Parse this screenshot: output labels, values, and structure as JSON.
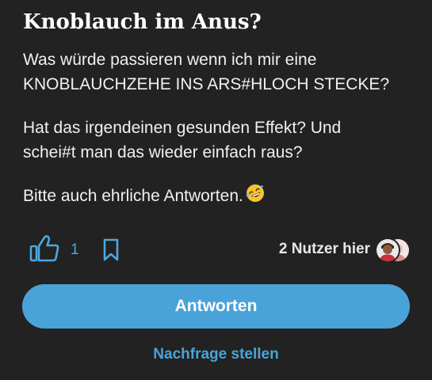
{
  "question": {
    "title": "Knoblauch im Anus?",
    "paragraph1": {
      "line1": "Was würde passieren wenn ich mir eine",
      "line2": "KNOBLAUCHZEHE INS ARS#HLOCH STECKE?"
    },
    "paragraph2": {
      "line1": "Hat das irgendeinen gesunden Effekt? Und",
      "line2": "schei#t man das wieder einfach raus?"
    },
    "paragraph3": "Bitte auch ehrliche Antworten.",
    "emoji": "rolling-on-floor-laughing-emoji"
  },
  "actions": {
    "like_count": "1",
    "like_icon": "thumbs-up-icon",
    "bookmark_icon": "bookmark-icon",
    "users_here": "2 Nutzer hier"
  },
  "buttons": {
    "answer": "Antworten",
    "followup": "Nachfrage stellen"
  },
  "colors": {
    "background": "#222222",
    "accent": "#4aa3d8",
    "text": "#ffffff"
  }
}
